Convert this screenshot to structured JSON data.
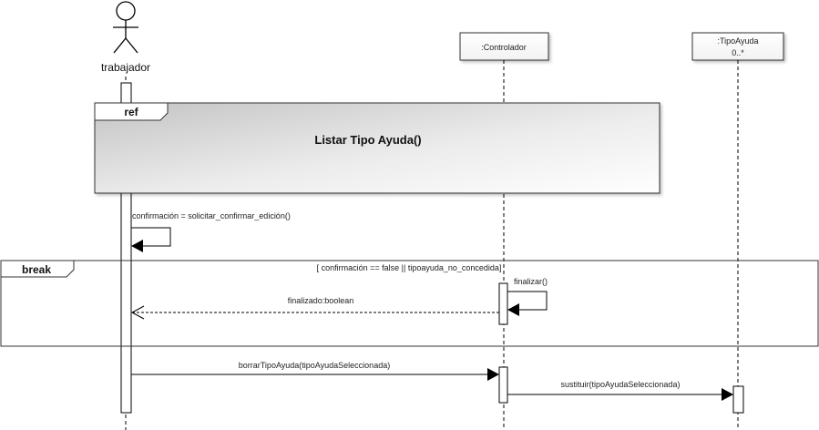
{
  "actors": {
    "trabajador": "trabajador"
  },
  "lifelines": {
    "controlador": ":Controlador",
    "tipo_ayuda_line1": ":TipoAyuda",
    "tipo_ayuda_line2": "0..*"
  },
  "ref_fragment": {
    "tag": "ref",
    "title": "Listar Tipo Ayuda()"
  },
  "break_fragment": {
    "tag": "break",
    "guard": "[ confirmación == false || tipoayuda_no_concedida]"
  },
  "messages": {
    "confirmacion": "confirmación = solicitar_confirmar_edición()",
    "finalizar": "finalizar()",
    "finalizado": "finalizado:boolean",
    "borrar": "borrarTipoAyuda(tipoAyudaSeleccionada)",
    "sustituir": "sustituir(tipoAyudaSeleccionada)"
  },
  "colors": {
    "line": "#000000",
    "ref_gradient_start": "#ffffff",
    "ref_gradient_end": "#c8c8c8"
  }
}
